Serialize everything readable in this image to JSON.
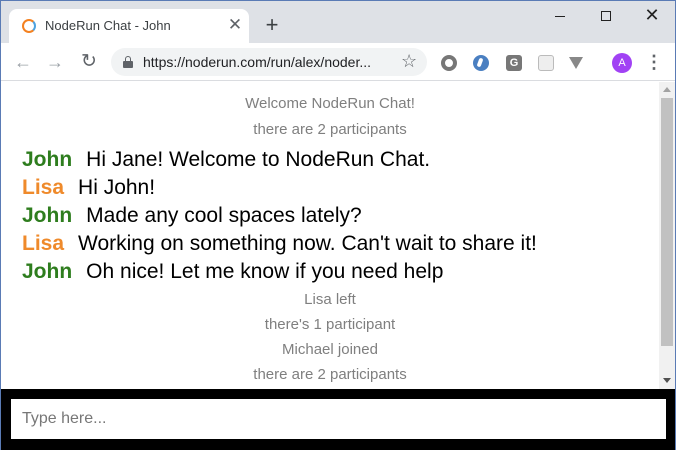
{
  "browser": {
    "tab_title": "NodeRun Chat - John",
    "tab_close": "✕",
    "new_tab": "+",
    "window_close": "✕",
    "url": "https://noderun.com/run/alex/noder...",
    "avatar_letter": "A",
    "extension_g": "G"
  },
  "chat": {
    "system_top": [
      "Welcome NodeRun Chat!",
      "there are 2 participants"
    ],
    "messages": [
      {
        "name": "John",
        "text": "Hi Jane! Welcome to NodeRun Chat."
      },
      {
        "name": "Lisa",
        "text": "Hi John!"
      },
      {
        "name": "John",
        "text": "Made any cool spaces lately?"
      },
      {
        "name": "Lisa",
        "text": "Working on something now. Can't wait to share it!"
      },
      {
        "name": "John",
        "text": "Oh nice! Let me know if you need help"
      }
    ],
    "system_bottom": [
      "Lisa left",
      "there's 1 participant",
      "Michael joined",
      "there are 2 participants"
    ],
    "input_placeholder": "Type here..."
  },
  "colors": {
    "john": "#2e7d1e",
    "lisa": "#ef8a2b",
    "system_text": "#7f7f7f",
    "input_bar": "#000000"
  }
}
